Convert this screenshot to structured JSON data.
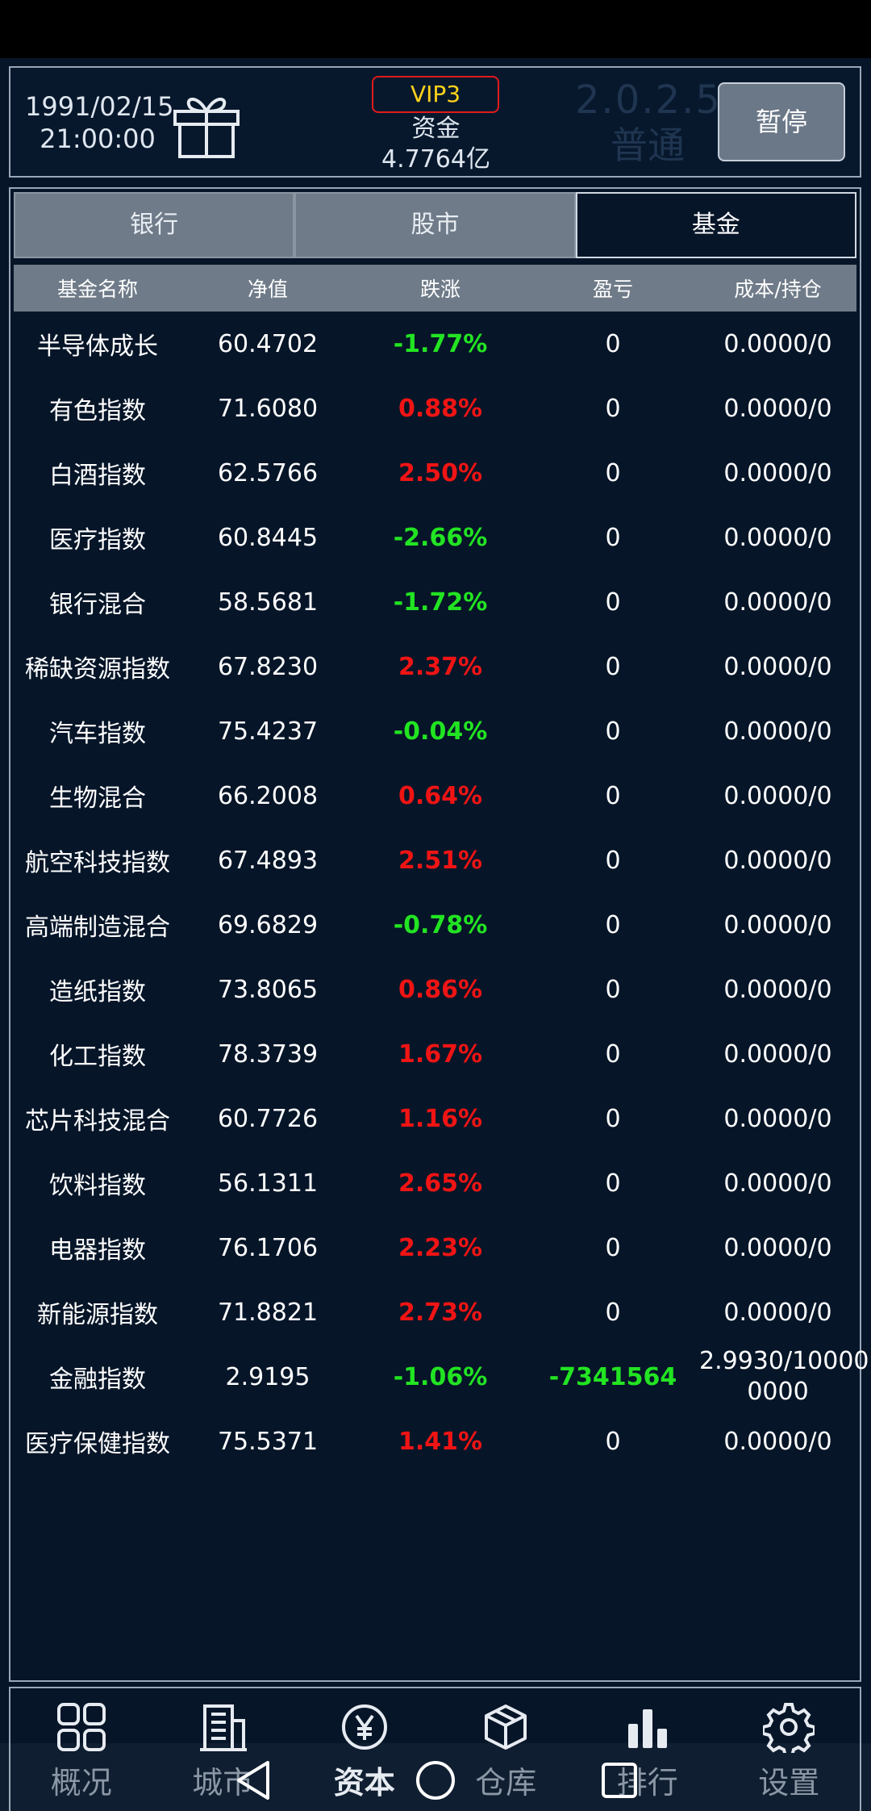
{
  "header": {
    "date": "1991/02/15",
    "time": "21:00:00",
    "vip": "VIP3",
    "fund_label": "资金",
    "fund_value": "4.7764亿",
    "version": "2.0.2.5",
    "mode": "普通",
    "pause_label": "暂停"
  },
  "tabs": [
    {
      "label": "银行"
    },
    {
      "label": "股市"
    },
    {
      "label": "基金",
      "active": true
    }
  ],
  "table": {
    "headers": [
      "基金名称",
      "净值",
      "跌涨",
      "盈亏",
      "成本/持仓"
    ],
    "rows": [
      {
        "name": "半导体成长",
        "nav": "60.4702",
        "change": "-1.77%",
        "pnl": "0",
        "cost": "0.0000/0"
      },
      {
        "name": "有色指数",
        "nav": "71.6080",
        "change": "0.88%",
        "pnl": "0",
        "cost": "0.0000/0"
      },
      {
        "name": "白酒指数",
        "nav": "62.5766",
        "change": "2.50%",
        "pnl": "0",
        "cost": "0.0000/0"
      },
      {
        "name": "医疗指数",
        "nav": "60.8445",
        "change": "-2.66%",
        "pnl": "0",
        "cost": "0.0000/0"
      },
      {
        "name": "银行混合",
        "nav": "58.5681",
        "change": "-1.72%",
        "pnl": "0",
        "cost": "0.0000/0"
      },
      {
        "name": "稀缺资源指数",
        "nav": "67.8230",
        "change": "2.37%",
        "pnl": "0",
        "cost": "0.0000/0"
      },
      {
        "name": "汽车指数",
        "nav": "75.4237",
        "change": "-0.04%",
        "pnl": "0",
        "cost": "0.0000/0"
      },
      {
        "name": "生物混合",
        "nav": "66.2008",
        "change": "0.64%",
        "pnl": "0",
        "cost": "0.0000/0"
      },
      {
        "name": "航空科技指数",
        "nav": "67.4893",
        "change": "2.51%",
        "pnl": "0",
        "cost": "0.0000/0"
      },
      {
        "name": "高端制造混合",
        "nav": "69.6829",
        "change": "-0.78%",
        "pnl": "0",
        "cost": "0.0000/0"
      },
      {
        "name": "造纸指数",
        "nav": "73.8065",
        "change": "0.86%",
        "pnl": "0",
        "cost": "0.0000/0"
      },
      {
        "name": "化工指数",
        "nav": "78.3739",
        "change": "1.67%",
        "pnl": "0",
        "cost": "0.0000/0"
      },
      {
        "name": "芯片科技混合",
        "nav": "60.7726",
        "change": "1.16%",
        "pnl": "0",
        "cost": "0.0000/0"
      },
      {
        "name": "饮料指数",
        "nav": "56.1311",
        "change": "2.65%",
        "pnl": "0",
        "cost": "0.0000/0"
      },
      {
        "name": "电器指数",
        "nav": "76.1706",
        "change": "2.23%",
        "pnl": "0",
        "cost": "0.0000/0"
      },
      {
        "name": "新能源指数",
        "nav": "71.8821",
        "change": "2.73%",
        "pnl": "0",
        "cost": "0.0000/0"
      },
      {
        "name": "金融指数",
        "nav": "2.9195",
        "change": "-1.06%",
        "pnl": "-7341564",
        "cost": "2.9930/10000\n0000"
      },
      {
        "name": "医疗保健指数",
        "nav": "75.5371",
        "change": "1.41%",
        "pnl": "0",
        "cost": "0.0000/0"
      }
    ]
  },
  "colors": {
    "rise": "#f01414",
    "fall": "#22e422",
    "background": "#061528"
  },
  "nav": [
    {
      "label": "概况",
      "icon": "grid-icon"
    },
    {
      "label": "城市",
      "icon": "building-icon"
    },
    {
      "label": "资本",
      "icon": "yen-icon",
      "active": true
    },
    {
      "label": "仓库",
      "icon": "box-icon"
    },
    {
      "label": "排行",
      "icon": "bar-chart-icon"
    },
    {
      "label": "设置",
      "icon": "gear-icon"
    }
  ]
}
